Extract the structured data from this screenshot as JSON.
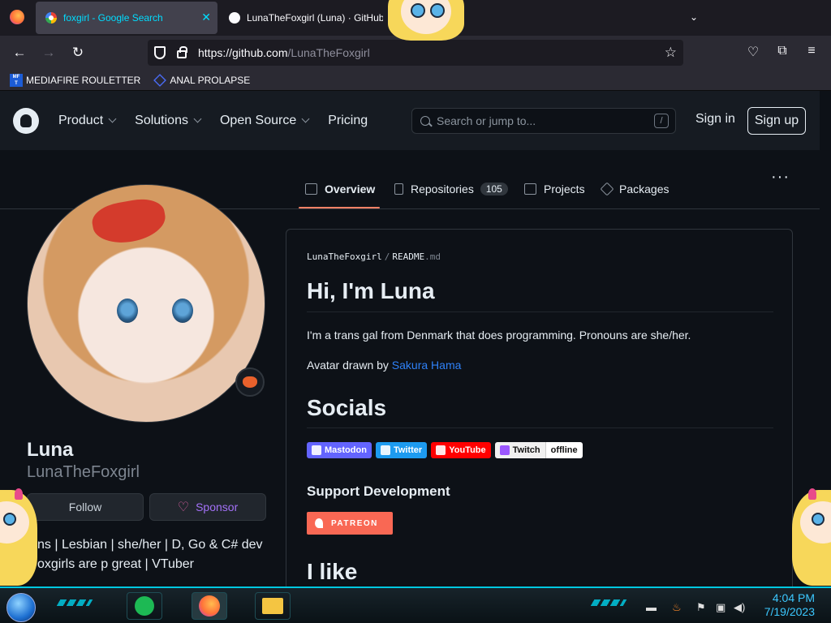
{
  "browser": {
    "tabs": [
      {
        "title": "foxgirl - Google Search",
        "active": true
      },
      {
        "title": "LunaTheFoxgirl (Luna) · GitHub",
        "active": false
      }
    ],
    "url_host": "https://github.com",
    "url_path": "/LunaTheFoxgirl",
    "bookmarks": [
      {
        "label": "MEDIAFIRE ROULETTER",
        "icon": "mediafire-icon"
      },
      {
        "label": "ANAL PROLAPSE",
        "icon": "bookmark-diamond-icon"
      }
    ]
  },
  "github": {
    "nav": [
      "Product",
      "Solutions",
      "Open Source",
      "Pricing"
    ],
    "search_placeholder": "Search or jump to...",
    "search_shortcut": "/",
    "sign_in": "Sign in",
    "sign_up": "Sign up",
    "profile_tabs": {
      "overview": "Overview",
      "repositories": "Repositories",
      "repositories_count": "105",
      "projects": "Projects",
      "packages": "Packages"
    }
  },
  "profile": {
    "name": "Luna",
    "login": "LunaTheFoxgirl",
    "follow": "Follow",
    "sponsor": "Sponsor",
    "bio_line1": "ns | Lesbian | she/her | D, Go & C# dev",
    "bio_line2": "oxgirls are p great | VTuber"
  },
  "readme": {
    "path_user": "LunaTheFoxgirl",
    "path_sep": "/",
    "path_file": "README",
    "path_ext": ".md",
    "heading": "Hi, I'm Luna",
    "intro": "I'm a trans gal from Denmark that does programming. Pronouns are she/her.",
    "avatar_credit_prefix": "Avatar drawn by ",
    "avatar_credit_link": "Sakura Hama",
    "socials_heading": "Socials",
    "badges": {
      "mastodon": "Mastodon",
      "twitter": "Twitter",
      "youtube": "YouTube",
      "twitch": "Twitch",
      "twitch_status": "offline"
    },
    "support_heading": "Support Development",
    "patreon": "PATREON",
    "like_heading": "I like"
  },
  "taskbar": {
    "time": "4:04 PM",
    "date": "7/19/2023"
  },
  "colors": {
    "accent_tab": "#00ddff",
    "link": "#2f81f7",
    "active_underline": "#f78166",
    "patreon": "#f96854",
    "clock": "#3cc8ff"
  }
}
